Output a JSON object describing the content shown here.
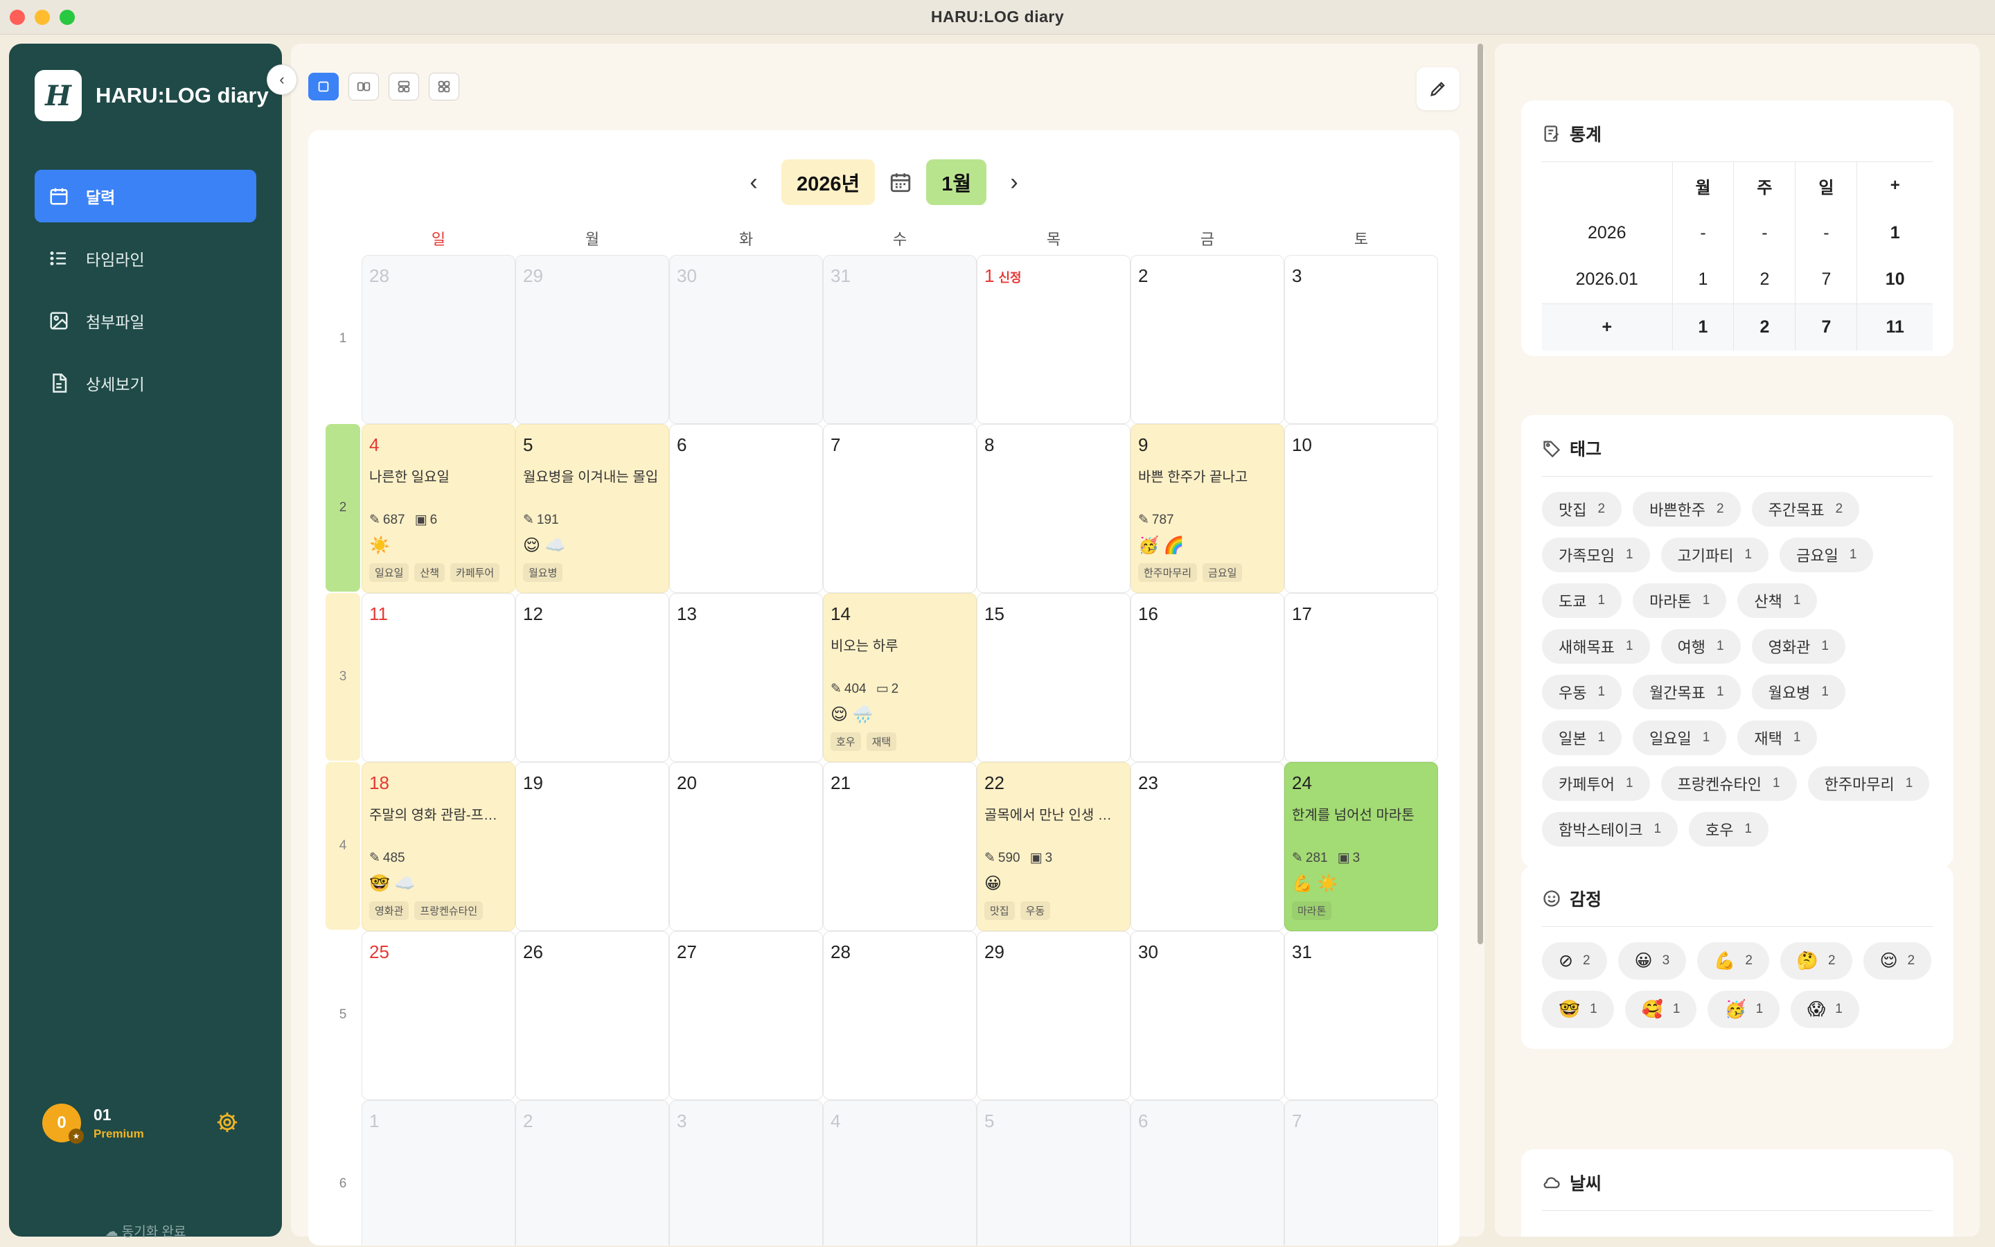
{
  "window": {
    "title": "HARU:LOG diary"
  },
  "sidebar": {
    "brand": "HARU:LOG diary",
    "logo_letter": "H",
    "nav": [
      {
        "label": "달력",
        "icon": "calendar-icon",
        "active": true
      },
      {
        "label": "타임라인",
        "icon": "list-icon",
        "active": false
      },
      {
        "label": "첨부파일",
        "icon": "image-icon",
        "active": false
      },
      {
        "label": "상세보기",
        "icon": "document-icon",
        "active": false
      }
    ],
    "profile": {
      "avatar": "0",
      "name": "01",
      "plan": "Premium"
    },
    "sync": "동기화 완료"
  },
  "calendar": {
    "year": "2026년",
    "month": "1월",
    "weekdays": [
      "일",
      "월",
      "화",
      "수",
      "목",
      "금",
      "토"
    ],
    "week_labels": [
      "1",
      "2",
      "3",
      "4",
      "5",
      "6"
    ],
    "active_week": 2,
    "weeks": [
      [
        {
          "d": "28",
          "out": true
        },
        {
          "d": "29",
          "out": true
        },
        {
          "d": "30",
          "out": true
        },
        {
          "d": "31",
          "out": true
        },
        {
          "d": "1",
          "red": true,
          "holiday": "신정"
        },
        {
          "d": "2"
        },
        {
          "d": "3"
        }
      ],
      [
        {
          "d": "4",
          "red": true,
          "entry": {
            "title": "나른한 일요일",
            "chars": "687",
            "images": "6",
            "emoji": "☀️",
            "tags": [
              "일요일",
              "산책",
              "카페투어"
            ]
          }
        },
        {
          "d": "5",
          "entry": {
            "title": "월요병을 이겨내는 몰입",
            "chars": "191",
            "emoji": "😌 ☁️",
            "tags": [
              "월요병"
            ]
          }
        },
        {
          "d": "6"
        },
        {
          "d": "7"
        },
        {
          "d": "8"
        },
        {
          "d": "9",
          "entry": {
            "title": "바쁜 한주가 끝나고",
            "chars": "787",
            "emoji": "🥳 🌈",
            "tags": [
              "한주마무리",
              "금요일"
            ]
          }
        },
        {
          "d": "10"
        }
      ],
      [
        {
          "d": "11",
          "red": true
        },
        {
          "d": "12"
        },
        {
          "d": "13"
        },
        {
          "d": "14",
          "entry": {
            "title": "비오는 하루",
            "chars": "404",
            "videos": "2",
            "emoji": "😌 🌧️",
            "tags": [
              "호우",
              "재택"
            ]
          }
        },
        {
          "d": "15"
        },
        {
          "d": "16"
        },
        {
          "d": "17"
        }
      ],
      [
        {
          "d": "18",
          "red": true,
          "entry": {
            "title": "주말의 영화 관람-프랑...",
            "chars": "485",
            "emoji": "🤓 ☁️",
            "tags": [
              "영화관",
              "프랑켄슈타인"
            ]
          }
        },
        {
          "d": "19"
        },
        {
          "d": "20"
        },
        {
          "d": "21"
        },
        {
          "d": "22",
          "entry": {
            "title": "골목에서 만난 인생 우동",
            "chars": "590",
            "images": "3",
            "emoji": "😀",
            "tags": [
              "맛집",
              "우동"
            ]
          }
        },
        {
          "d": "23"
        },
        {
          "d": "24",
          "green": true,
          "entry": {
            "title": "한계를 넘어선 마라톤",
            "chars": "281",
            "images": "3",
            "emoji": "💪 ☀️",
            "tags": [
              "마라톤"
            ]
          }
        }
      ],
      [
        {
          "d": "25",
          "red": true
        },
        {
          "d": "26"
        },
        {
          "d": "27"
        },
        {
          "d": "28"
        },
        {
          "d": "29"
        },
        {
          "d": "30"
        },
        {
          "d": "31"
        }
      ],
      [
        {
          "d": "1",
          "out": true
        },
        {
          "d": "2",
          "out": true
        },
        {
          "d": "3",
          "out": true
        },
        {
          "d": "4",
          "out": true
        },
        {
          "d": "5",
          "out": true
        },
        {
          "d": "6",
          "out": true
        },
        {
          "d": "7",
          "out": true
        }
      ]
    ]
  },
  "stats": {
    "title": "통계",
    "headers": [
      "",
      "월",
      "주",
      "일",
      "+"
    ],
    "rows": [
      [
        "2026",
        "-",
        "-",
        "-",
        "1"
      ],
      [
        "2026.01",
        "1",
        "2",
        "7",
        "10"
      ]
    ],
    "total": [
      "+",
      "1",
      "2",
      "7",
      "11"
    ]
  },
  "tags": {
    "title": "태그",
    "items": [
      {
        "name": "맛집",
        "count": "2"
      },
      {
        "name": "바쁜한주",
        "count": "2"
      },
      {
        "name": "주간목표",
        "count": "2"
      },
      {
        "name": "가족모임",
        "count": "1"
      },
      {
        "name": "고기파티",
        "count": "1"
      },
      {
        "name": "금요일",
        "count": "1"
      },
      {
        "name": "도쿄",
        "count": "1"
      },
      {
        "name": "마라톤",
        "count": "1"
      },
      {
        "name": "산책",
        "count": "1"
      },
      {
        "name": "새해목표",
        "count": "1"
      },
      {
        "name": "여행",
        "count": "1"
      },
      {
        "name": "영화관",
        "count": "1"
      },
      {
        "name": "우동",
        "count": "1"
      },
      {
        "name": "월간목표",
        "count": "1"
      },
      {
        "name": "월요병",
        "count": "1"
      },
      {
        "name": "일본",
        "count": "1"
      },
      {
        "name": "일요일",
        "count": "1"
      },
      {
        "name": "재택",
        "count": "1"
      },
      {
        "name": "카페투어",
        "count": "1"
      },
      {
        "name": "프랑켄슈타인",
        "count": "1"
      },
      {
        "name": "한주마무리",
        "count": "1"
      },
      {
        "name": "함박스테이크",
        "count": "1"
      },
      {
        "name": "호우",
        "count": "1"
      }
    ]
  },
  "emotions": {
    "title": "감정",
    "items": [
      {
        "emoji": "⊘",
        "count": "2"
      },
      {
        "emoji": "😀",
        "count": "3"
      },
      {
        "emoji": "💪",
        "count": "2"
      },
      {
        "emoji": "🤔",
        "count": "2"
      },
      {
        "emoji": "😌",
        "count": "2"
      },
      {
        "emoji": "🤓",
        "count": "1"
      },
      {
        "emoji": "🥰",
        "count": "1"
      },
      {
        "emoji": "🥳",
        "count": "1"
      },
      {
        "emoji": "😱",
        "count": "1"
      }
    ]
  },
  "weather": {
    "title": "날씨"
  }
}
